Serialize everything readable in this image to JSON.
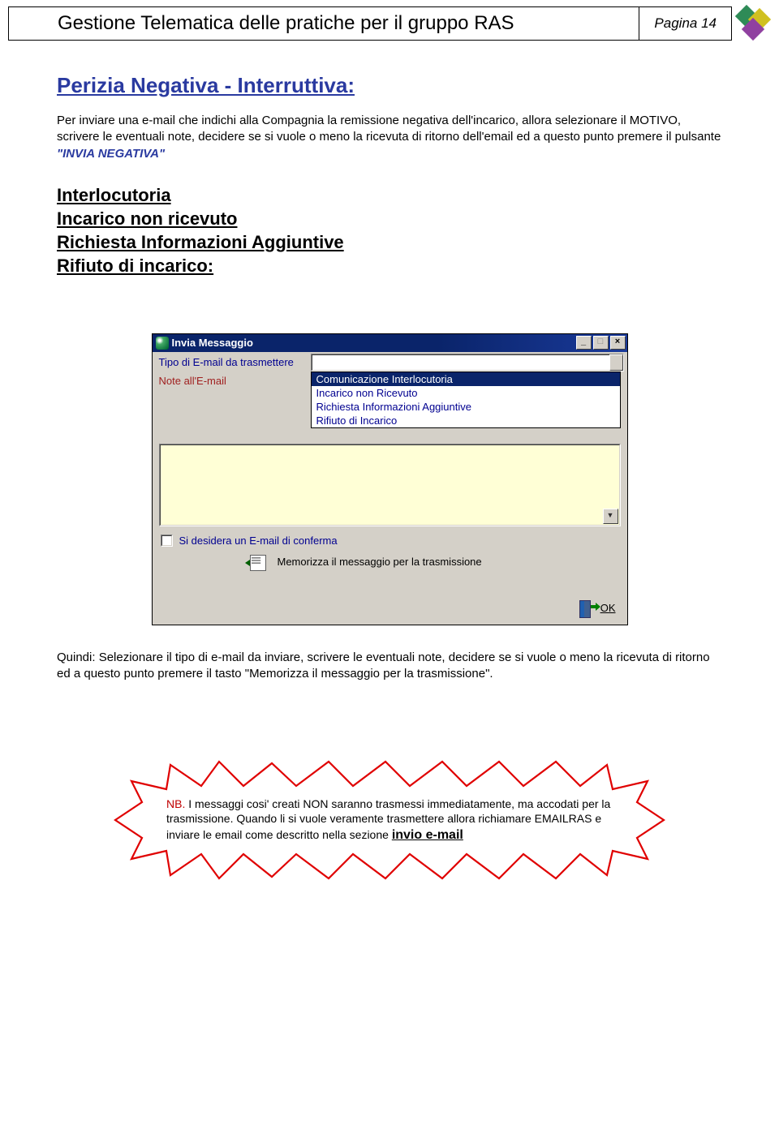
{
  "header": {
    "title": "Gestione Telematica delle pratiche per il gruppo RAS",
    "page_label": "Pagina 14"
  },
  "section": {
    "heading": "Perizia Negativa - Interruttiva:",
    "paragraph_pre": "Per inviare una e-mail che indichi alla Compagnia la remissione negativa dell'incarico, allora selezionare il MOTIVO, scrivere le eventuali note, decidere se si vuole o meno la ricevuta di ritorno dell'email ed a questo punto premere il pulsante ",
    "paragraph_emph": "\"INVIA NEGATIVA\""
  },
  "sublinks": {
    "a": "Interlocutoria",
    "b": "Incarico non ricevuto",
    "c": "Richiesta Informazioni Aggiuntive",
    "d": "Rifiuto di incarico:"
  },
  "dialog": {
    "title": "Invia Messaggio",
    "label_type": "Tipo di E-mail da trasmettere",
    "label_note": "Note all'E-mail",
    "dropdown": {
      "selected": "Comunicazione Interlocutoria",
      "opt2": "Incarico non Ricevuto",
      "opt3": "Richiesta Informazioni Aggiuntive",
      "opt4": "Rifiuto di Incarico"
    },
    "checkbox_label": "Si desidera un E-mail di conferma",
    "memo_label": "Memorizza il messaggio per la trasmissione",
    "ok_label": "OK"
  },
  "after_dialog": {
    "text": "Quindi: Selezionare il tipo di e-mail da inviare, scrivere le eventuali note, decidere se si vuole o meno la ricevuta di ritorno ed a questo punto premere il tasto \"Memorizza il messaggio per la trasmissione\"."
  },
  "note": {
    "prefix": "NB.",
    "body": " I messaggi cosi' creati NON saranno trasmessi immediatamente, ma accodati per la trasmissione. Quando li si vuole veramente trasmettere allora richiamare EMAILRAS e inviare le email come descritto nella sezione ",
    "link": "invio e-mail"
  }
}
